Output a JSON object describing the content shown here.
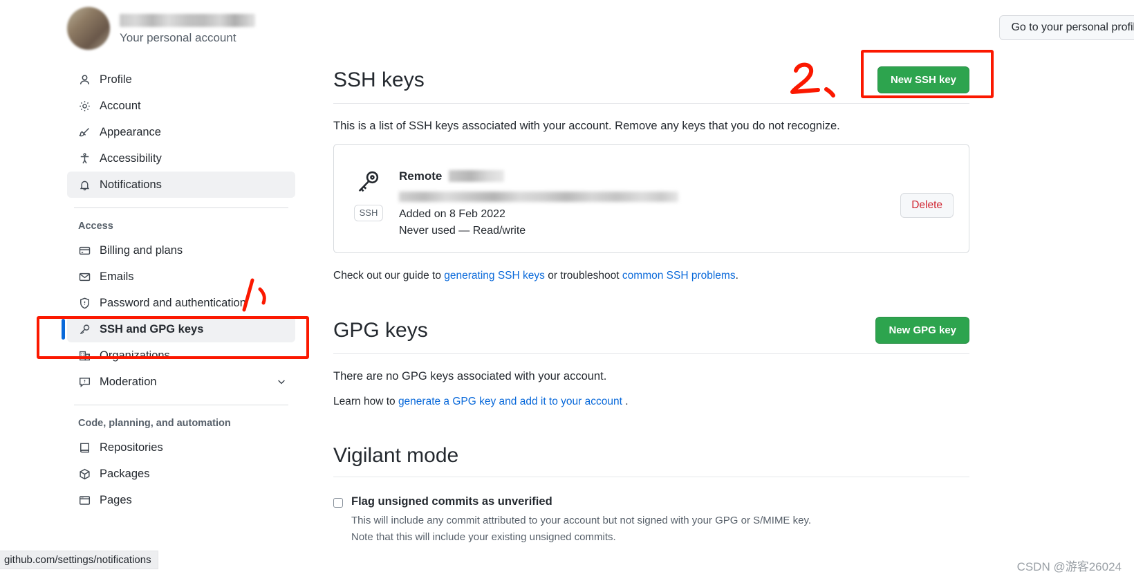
{
  "header": {
    "account_subtitle": "Your personal account",
    "profile_button": "Go to your personal profile"
  },
  "sidebar": {
    "items_top": [
      {
        "label": "Profile",
        "icon": "person-icon",
        "selected": false
      },
      {
        "label": "Account",
        "icon": "gear-icon",
        "selected": false
      },
      {
        "label": "Appearance",
        "icon": "paintbrush-icon",
        "selected": false
      },
      {
        "label": "Accessibility",
        "icon": "accessibility-icon",
        "selected": false
      },
      {
        "label": "Notifications",
        "icon": "bell-icon",
        "selected": false
      }
    ],
    "group_access_title": "Access",
    "items_access": [
      {
        "label": "Billing and plans",
        "icon": "credit-card-icon",
        "selected": false
      },
      {
        "label": "Emails",
        "icon": "mail-icon",
        "selected": false
      },
      {
        "label": "Password and authentication",
        "icon": "shield-lock-icon",
        "selected": false
      },
      {
        "label": "SSH and GPG keys",
        "icon": "key-icon",
        "selected": true
      },
      {
        "label": "Organizations",
        "icon": "organization-icon",
        "selected": false
      },
      {
        "label": "Moderation",
        "icon": "report-icon",
        "selected": false,
        "chevron": true
      }
    ],
    "group_code_title": "Code, planning, and automation",
    "items_code": [
      {
        "label": "Repositories",
        "icon": "repo-icon",
        "selected": false
      },
      {
        "label": "Packages",
        "icon": "package-icon",
        "selected": false
      },
      {
        "label": "Pages",
        "icon": "browser-icon",
        "selected": false
      }
    ]
  },
  "ssh_section": {
    "title": "SSH keys",
    "new_key_button": "New SSH key",
    "description": "This is a list of SSH keys associated with your account. Remove any keys that you do not recognize.",
    "key": {
      "badge": "SSH",
      "title": "Remote",
      "added": "Added on 8 Feb 2022",
      "usage": "Never used — Read/write",
      "delete_button": "Delete"
    },
    "guide_prefix": "Check out our guide to ",
    "guide_link_1": "generating SSH keys",
    "guide_middle": " or troubleshoot ",
    "guide_link_2": "common SSH problems",
    "guide_suffix": "."
  },
  "gpg_section": {
    "title": "GPG keys",
    "new_key_button": "New GPG key",
    "empty_text": "There are no GPG keys associated with your account.",
    "learn_prefix": "Learn how to ",
    "learn_link": "generate a GPG key and add it to your account",
    "learn_suffix": " ."
  },
  "vigilant_section": {
    "title": "Vigilant mode",
    "checkbox_label": "Flag unsigned commits as unverified",
    "sub_line_1": "This will include any commit attributed to your account but not signed with your GPG or S/MIME key.",
    "sub_line_2": "Note that this will include your existing unsigned commits."
  },
  "annotations": {
    "mark_one": "1",
    "mark_two": "2",
    "color": "#fb1800"
  },
  "status_bar": {
    "url": "github.com/settings/notifications"
  },
  "watermark": "CSDN @游客26024"
}
